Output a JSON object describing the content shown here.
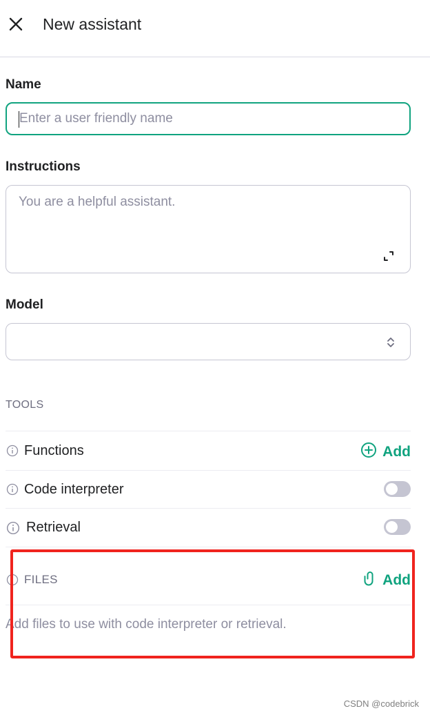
{
  "header": {
    "title": "New assistant",
    "close_icon": "close-icon"
  },
  "name": {
    "label": "Name",
    "placeholder": "Enter a user friendly name",
    "value": ""
  },
  "instructions": {
    "label": "Instructions",
    "placeholder": "You are a helpful assistant.",
    "value": ""
  },
  "model": {
    "label": "Model",
    "selected": ""
  },
  "tools": {
    "heading": "TOOLS",
    "functions": {
      "label": "Functions",
      "add_label": "Add",
      "icon": "plus-circle-icon"
    },
    "code_interpreter": {
      "label": "Code interpreter",
      "enabled": false
    },
    "retrieval": {
      "label": "Retrieval",
      "enabled": false
    }
  },
  "files": {
    "heading": "FILES",
    "add_label": "Add",
    "icon": "paperclip-icon",
    "empty_text": "Add files to use with code interpreter or retrieval."
  },
  "colors": {
    "accent": "#10a37f",
    "highlight_border": "#f0241e",
    "toggle_off": "#c5c5d2"
  },
  "watermark": "CSDN @codebrick"
}
